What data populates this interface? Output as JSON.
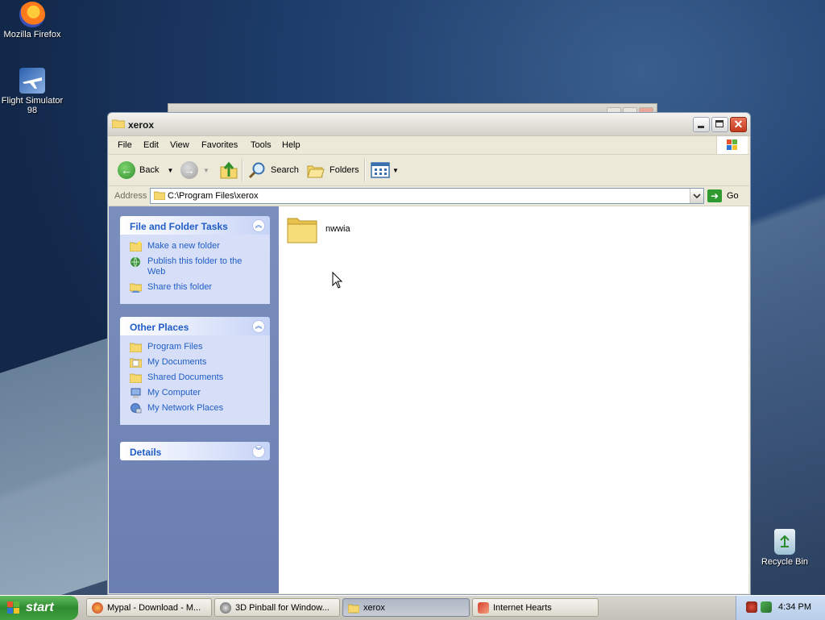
{
  "desktop": {
    "icons": [
      {
        "label": "Mozilla Firefox",
        "icon": "firefox-icon"
      },
      {
        "label": "Flight Simulator 98",
        "icon": "flight-simulator-icon"
      },
      {
        "label": "Recycle Bin",
        "icon": "recycle-bin-icon"
      }
    ]
  },
  "window": {
    "title": "xerox",
    "menu": [
      "File",
      "Edit",
      "View",
      "Favorites",
      "Tools",
      "Help"
    ],
    "toolbar": {
      "back_label": "Back",
      "search_label": "Search",
      "folders_label": "Folders"
    },
    "address": {
      "label": "Address",
      "value": "C:\\Program Files\\xerox",
      "go_label": "Go"
    },
    "tasks_panel": {
      "title": "File and Folder Tasks",
      "items": [
        {
          "label": "Make a new folder",
          "icon": "new-folder-icon"
        },
        {
          "label": "Publish this folder to the Web",
          "icon": "publish-web-icon"
        },
        {
          "label": "Share this folder",
          "icon": "share-folder-icon"
        }
      ]
    },
    "places_panel": {
      "title": "Other Places",
      "items": [
        {
          "label": "Program Files",
          "icon": "folder-icon"
        },
        {
          "label": "My Documents",
          "icon": "my-documents-icon"
        },
        {
          "label": "Shared Documents",
          "icon": "folder-icon"
        },
        {
          "label": "My Computer",
          "icon": "my-computer-icon"
        },
        {
          "label": "My Network Places",
          "icon": "network-places-icon"
        }
      ]
    },
    "details_panel": {
      "title": "Details"
    },
    "content": {
      "items": [
        {
          "label": "nwwia",
          "icon": "folder-icon"
        }
      ]
    }
  },
  "taskbar": {
    "start_label": "start",
    "buttons": [
      {
        "label": "Mypal - Download - M...",
        "active": false
      },
      {
        "label": "3D Pinball for Window...",
        "active": false
      },
      {
        "label": "xerox",
        "active": true
      },
      {
        "label": "Internet Hearts",
        "active": false
      }
    ],
    "clock": "4:34 PM"
  },
  "colors": {
    "link_blue": "#215dc6",
    "task_pane": "#6a7fb0",
    "start_green": "#3fa33f",
    "folder_yellow": "#f5d76e"
  }
}
